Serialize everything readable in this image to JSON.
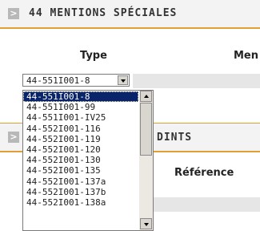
{
  "section1": {
    "title": "44 MENTIONS SPÉCIALES"
  },
  "section2": {
    "title": "DINTS"
  },
  "table": {
    "col_type": "Type",
    "col_mentions": "Men",
    "col_reference": "Référence"
  },
  "type_select": {
    "value": "44-551I001-8",
    "options": [
      "44-551I001-8",
      "44-551I001-99",
      "44-551I001-IV25",
      "44-552I001-116",
      "44-552I001-119",
      "44-552I001-120",
      "44-552I001-130",
      "44-552I001-135",
      "44-552I001-137a",
      "44-552I001-137b",
      "44-552I001-138a"
    ],
    "selected_index": 0
  },
  "colors": {
    "accent": "#e0a033",
    "selection": "#0a246a",
    "band": "#e6e6e6"
  }
}
